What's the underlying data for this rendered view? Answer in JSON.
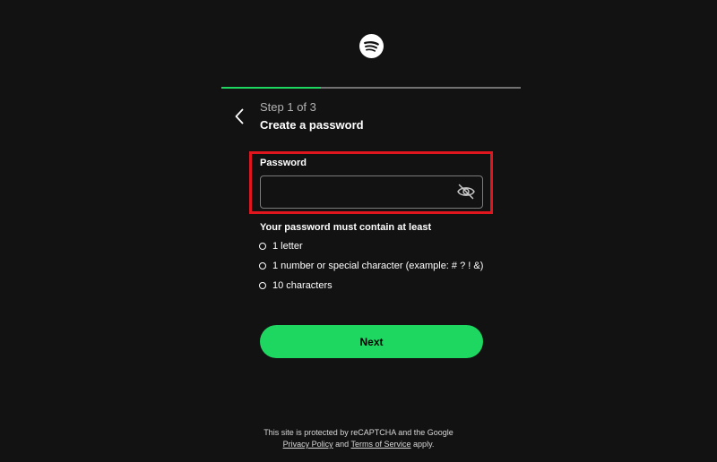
{
  "colors": {
    "background": "#121212",
    "accent": "#1ed760",
    "highlight": "#e0161e",
    "muted_text": "#b3b3b3",
    "input_border": "#7c7c7c"
  },
  "logo": {
    "icon": "spotify-logo-icon"
  },
  "progress": {
    "current_step": 1,
    "total_steps": 3,
    "fraction": 0.333
  },
  "header": {
    "back_icon": "chevron-left-icon",
    "step_label": "Step 1 of 3",
    "title": "Create a password"
  },
  "password": {
    "label": "Password",
    "value": "",
    "placeholder": "",
    "toggle_icon": "eye-off-icon"
  },
  "requirements": {
    "heading": "Your password must contain at least",
    "items": [
      {
        "label": "1 letter"
      },
      {
        "label": "1 number or special character (example: # ? ! &)"
      },
      {
        "label": "10 characters"
      }
    ]
  },
  "next_button": {
    "label": "Next"
  },
  "footer": {
    "line1": "This site is protected by reCAPTCHA and the Google",
    "privacy_link": "Privacy Policy",
    "and_text": "and",
    "terms_link": "Terms of Service",
    "apply_text": "apply."
  }
}
